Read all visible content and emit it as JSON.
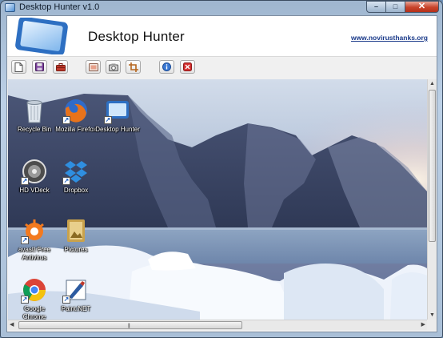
{
  "window": {
    "title": "Desktop Hunter v1.0",
    "controls": {
      "minimize": "–",
      "maximize": "□",
      "close": "✕"
    }
  },
  "header": {
    "app_name": "Desktop Hunter",
    "website": "www.novirusthanks.org"
  },
  "toolbar": {
    "buttons": [
      {
        "name": "new",
        "icon": "new-document-icon"
      },
      {
        "name": "save",
        "icon": "save-disk-icon"
      },
      {
        "name": "toolbox",
        "icon": "toolbox-icon"
      },
      {
        "name": "capture-full",
        "icon": "screen-icon"
      },
      {
        "name": "capture-camera",
        "icon": "camera-icon"
      },
      {
        "name": "crop",
        "icon": "crop-icon"
      },
      {
        "name": "about",
        "icon": "info-icon"
      },
      {
        "name": "exit",
        "icon": "exit-icon"
      }
    ]
  },
  "desktop": {
    "icons": [
      {
        "label": "Recycle Bin",
        "icon": "recycle-bin-icon",
        "shortcut": false
      },
      {
        "label": "Mozilla Firefox",
        "icon": "firefox-icon",
        "shortcut": true
      },
      {
        "label": "Desktop Hunter",
        "icon": "desktop-hunter-icon",
        "shortcut": true
      },
      {
        "label": "HD VDeck",
        "icon": "hd-vdeck-icon",
        "shortcut": true
      },
      {
        "label": "Dropbox",
        "icon": "dropbox-icon",
        "shortcut": true
      },
      {
        "label": "avast! Free Antivirus",
        "icon": "avast-icon",
        "shortcut": true
      },
      {
        "label": "Pictures",
        "icon": "pictures-folder-icon",
        "shortcut": false
      },
      {
        "label": "Google Chrome",
        "icon": "chrome-icon",
        "shortcut": true
      },
      {
        "label": "Paint.NET",
        "icon": "paint-net-icon",
        "shortcut": true
      }
    ]
  },
  "colors": {
    "link": "#1a3a8a",
    "close_button": "#c8432a",
    "frame": "#a9bfd7"
  }
}
